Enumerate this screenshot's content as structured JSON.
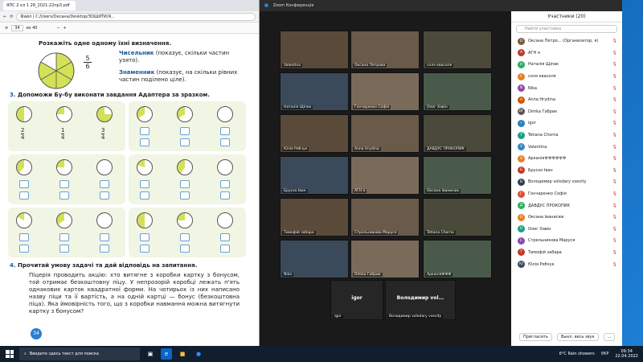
{
  "pdf": {
    "tab": "ЯПС 2 кл 1 28_2021-22пр3.pdf",
    "address_label": "Файл",
    "address": "C:/Users/Оксана/Desktop/ЗОШИТИ/Я...",
    "page_num": "34",
    "page_total": "из 40",
    "intro": "Розкажіть одне одному їхні визначення.",
    "frac_num": "5",
    "frac_den": "6",
    "numerator": "Чисельник",
    "numerator_desc": "(показує, скільки частин узято).",
    "denominator": "Знаменник",
    "denominator_desc": "(показує, на скільки рівних частин поділено ціле).",
    "task3_num": "3.",
    "task3": "Допоможи Бу-бу виконати завдання Адаптера за зразком.",
    "ex": {
      "a": "2",
      "b": "1",
      "c": "3",
      "den": "4"
    },
    "task4_num": "4.",
    "task4": "Прочитай умову задачі та дай відповідь на запитання.",
    "problem": "Піцерія проводить акцію: хто витягне з коробки картку з бонусом, той отримає безкоштовну піцу. У непрозорій коробці лежать п'ять однакових карток квадратної форми. На чотирьох із них написано назву піци та її вартість, а на одній картці — бонус (безкоштовна піца). Яка ймовірність того, що з коробки навмання можна витягнути картку з бонусом?",
    "page_badge": "34"
  },
  "zoom": {
    "title": "Zoom Конференція",
    "tiles": [
      "Valentina",
      "Оксана Петрова",
      "соля квасоля",
      "Наталія Щіпак",
      "Гончаренко Софія",
      "Олег Хавін",
      "Юлія Рябчук",
      "Anna Hrydina",
      "ДАВДУС ПРОКОПИК",
      "Брусхо Іван",
      "АГН я",
      "Оксана Іванисюк",
      "Тимофій забара",
      "Стрельникова Маруся",
      "Tetiana Chorna",
      "Nikа",
      "Dimka Габрик",
      "Арканія☢☢☢"
    ],
    "tile_bottom": [
      "igor",
      "Володимир volodary vsevity"
    ],
    "tile_bottom_big": [
      "igor",
      "Володимир vol..."
    ]
  },
  "participants": {
    "header": "Участники (20)",
    "search": "Найти участника",
    "list": [
      {
        "initial": "О",
        "name": "Оксана Петро... (Организатор, я)",
        "color": "#7a5a3a"
      },
      {
        "initial": "А",
        "name": "АГН я",
        "color": "#c0392b"
      },
      {
        "initial": "Н",
        "name": "Наталія Щіпак",
        "color": "#27ae60"
      },
      {
        "initial": "С",
        "name": "соля квасоля",
        "color": "#e67e22"
      },
      {
        "initial": "N",
        "name": "Nika",
        "color": "#8e44ad"
      },
      {
        "initial": "A",
        "name": "Anna Hrydina",
        "color": "#d35400"
      },
      {
        "initial": "DГ",
        "name": "Dimka Габрик",
        "color": "#555"
      },
      {
        "initial": "I",
        "name": "igor",
        "color": "#2980b9"
      },
      {
        "initial": "T",
        "name": "Tetiana Chorna",
        "color": "#16a085"
      },
      {
        "initial": "V",
        "name": "Valentina",
        "color": "#2e86c1"
      },
      {
        "initial": "A",
        "name": "Арканія☢☢☢☢☢☢",
        "color": "#e67e22"
      },
      {
        "initial": "Б",
        "name": "Брусхо Іван",
        "color": "#c0392b"
      },
      {
        "initial": "В",
        "name": "Володимир volodary vsevity",
        "color": "#2c3e50"
      },
      {
        "initial": "Г",
        "name": "Гончаренко Софія",
        "color": "#e74c3c"
      },
      {
        "initial": "Д",
        "name": "ДАВДУС ПРОКОПИК",
        "color": "#27ae60"
      },
      {
        "initial": "О",
        "name": "Оксана Іванисюк",
        "color": "#e67e22"
      },
      {
        "initial": "О",
        "name": "Олег Хавін",
        "color": "#16a085"
      },
      {
        "initial": "С",
        "name": "Стрельникова Маруся",
        "color": "#8e44ad"
      },
      {
        "initial": "Т",
        "name": "Тимофій забара",
        "color": "#c0392b"
      },
      {
        "initial": "Ю",
        "name": "Юлія Рябчук",
        "color": "#34495e"
      }
    ],
    "invite": "Пригласить",
    "mute_all": "Выкл. весь звук",
    "more": "..."
  },
  "taskbar": {
    "search": "Введите здесь текст для поиска",
    "weather": "6°C Rain showers",
    "lang": "УКР",
    "time": "09:34",
    "date": "22.04.2022"
  }
}
